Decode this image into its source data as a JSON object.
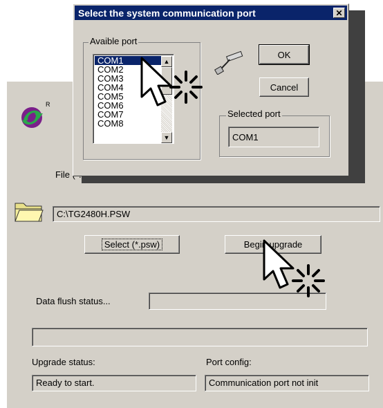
{
  "dialog": {
    "title": "Select the system communication port",
    "close_glyph": "✕",
    "available_group_label": "Avaible port",
    "ports": [
      "COM1",
      "COM2",
      "COM3",
      "COM4",
      "COM5",
      "COM6",
      "COM7",
      "COM8"
    ],
    "selected_index": 0,
    "ok_label": "OK",
    "cancel_label": "Cancel",
    "selected_group_label": "Selected port",
    "selected_port_value": "COM1"
  },
  "main": {
    "logo_mark": "R",
    "file_label": "File (*.psw):",
    "file_path": "C:\\TG2480H.PSW",
    "select_button": "Select (*.psw)",
    "begin_button": "Begin upgrade",
    "data_flush_label": "Data flush status...",
    "data_flush_value": "",
    "progress_value": "",
    "upgrade_status_label": "Upgrade status:",
    "upgrade_status_value": "Ready to start.",
    "port_config_label": "Port config:",
    "port_config_value": "Communication port not init"
  },
  "colors": {
    "titlebar": "#0a246a",
    "window_face": "#d4d0c8",
    "logo_purple": "#7a1f8a",
    "logo_green": "#2aa84a",
    "folder_yellow": "#f0e68c"
  },
  "icons": [
    "logo-icon",
    "folder-icon",
    "serial-cable-icon",
    "pointer-cursor-icon",
    "close-icon"
  ]
}
